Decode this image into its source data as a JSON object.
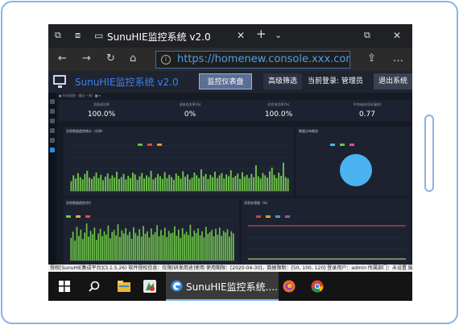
{
  "browser": {
    "tab_title": "SunuHIE监控系统 v2.0",
    "url": "https://homenew.console.xxx.com/",
    "icons": [
      "tab-actions-icon",
      "back-tabs-icon",
      "tab-page-icon",
      "close-icon",
      "plus-icon",
      "chevron-down-icon",
      "back-icon",
      "forward-icon",
      "refresh-icon",
      "home-icon",
      "info-icon",
      "share-icon",
      "ellipsis-icon",
      "restore-icon"
    ]
  },
  "app": {
    "title": "SunuHIE监控系统 v2.0",
    "nav_dashboard": "监控仪表盘",
    "nav_filter": "高级筛选",
    "login_label": "当前登录: 管理员",
    "logout": "退出系统"
  },
  "dashboard": {
    "crumb": "● 时间周期（最近一周）■ ▾",
    "kpis": [
      {
        "label": "消息成功率",
        "value": "100.0%"
      },
      {
        "label": "消息丢失率(%)",
        "value": "0%"
      },
      {
        "label": "同步成功率(%)",
        "value": "100.0%"
      },
      {
        "label": "平均响应时间(毫秒)",
        "value": "0.77"
      }
    ],
    "panel_titles": [
      "消息数量趋势统计（分钟）",
      "数据分布概览",
      "消息数量趋势(秒)",
      "消息处理量（%）"
    ]
  },
  "chart_data": [
    {
      "type": "bar",
      "title": "消息数量趋势统计（分钟）",
      "series": [
        {
          "name": "",
          "color": "#6cc24a"
        }
      ],
      "ylim": [
        0,
        100
      ],
      "values": [
        22,
        35,
        28,
        40,
        31,
        26,
        38,
        45,
        30,
        27,
        33,
        41,
        29,
        36,
        24,
        32,
        39,
        28,
        35,
        30,
        43,
        27,
        31,
        38,
        26,
        34,
        29,
        41,
        37,
        25,
        33,
        40,
        28,
        35,
        31,
        45,
        26,
        30,
        38,
        33,
        27,
        42,
        29,
        36,
        31,
        25,
        39,
        34,
        28,
        44,
        32,
        37,
        26,
        30,
        41,
        35,
        29,
        48,
        33,
        38,
        27,
        36,
        31,
        43,
        29,
        35,
        40,
        28,
        37,
        33,
        46,
        30,
        34,
        39,
        27,
        42,
        32,
        36,
        29,
        38,
        31,
        57,
        33,
        28,
        40,
        35,
        30,
        44,
        52,
        36,
        29,
        41,
        34,
        63,
        31,
        28
      ]
    },
    {
      "type": "pie",
      "title": "数据分布概览",
      "values": [
        100
      ],
      "colors": [
        "#4bb3f0"
      ]
    },
    {
      "type": "bar",
      "title": "消息数量趋势(秒)",
      "ylim": [
        0,
        100
      ],
      "values": [
        55,
        70,
        48,
        82,
        60,
        75,
        52,
        68,
        90,
        58,
        72,
        64,
        80,
        50,
        66,
        77,
        59,
        71,
        63,
        85,
        54,
        69,
        74,
        61,
        88,
        57,
        73,
        66,
        79,
        62,
        70,
        53,
        81,
        67,
        60,
        76,
        58,
        84,
        65,
        71,
        56,
        78,
        63,
        69,
        86,
        59,
        74,
        61,
        80,
        57,
        72,
        66,
        68,
        83,
        60,
        75,
        55,
        79,
        64,
        70,
        62,
        87,
        58,
        73,
        67,
        78,
        61,
        71,
        56,
        82,
        65,
        69,
        74,
        59,
        77,
        63,
        80,
        60,
        72,
        68,
        76,
        58,
        71,
        66
      ]
    },
    {
      "type": "line",
      "title": "消息处理量（%）",
      "series": [
        {
          "name": "",
          "color": "#e84a4a",
          "level": 0.78
        },
        {
          "name": "",
          "color": "#d9c542",
          "level": 0.02
        },
        {
          "name": "",
          "color": "#4bb3f0",
          "level": 0.01
        }
      ]
    }
  ],
  "status_text": "授权[SunuHIE集成平台](3.1.5.26)    软件授权信息：仅限[研发用途]使用    使用期限：[2020-04-30]，数据限制：[50, 100, 120]    登录用户：admin 所属部门：未设置    服务器地址：http...",
  "taskbar": {
    "active_label": "SunuHIE监控系统....",
    "icons": [
      "windows-start-icon",
      "search-icon",
      "file-explorer-icon",
      "app-icon",
      "edge-icon",
      "firefox-icon",
      "chrome-icon"
    ]
  }
}
